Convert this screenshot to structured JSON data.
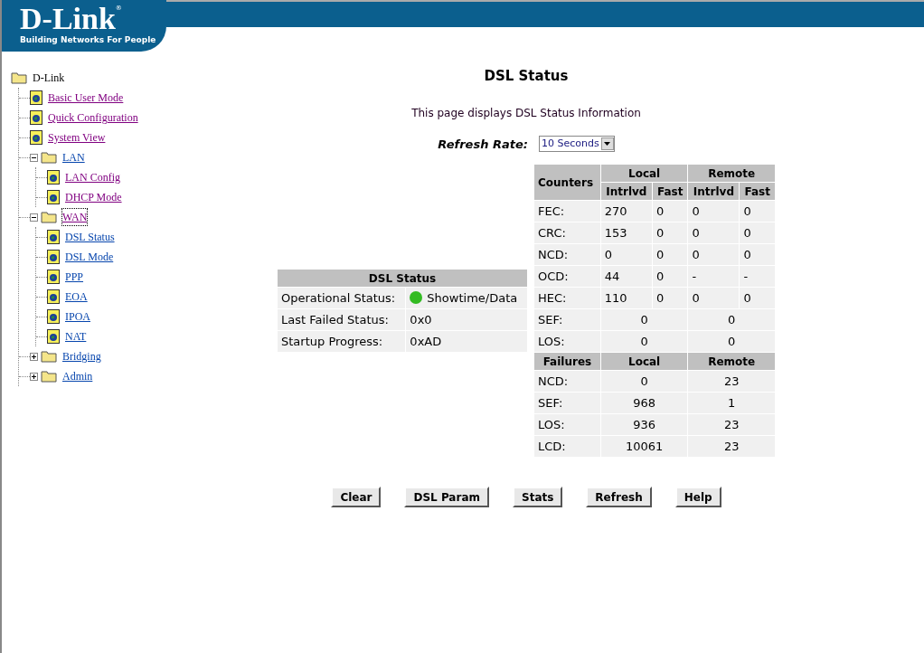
{
  "header": {
    "logo": "D-Link",
    "logo_mark": "®",
    "tagline": "Building Networks For People"
  },
  "tree": {
    "label": "D-Link",
    "children": [
      {
        "label": "Basic User Mode",
        "kind": "page",
        "visited": true,
        "focused": false
      },
      {
        "label": "Quick Configuration",
        "kind": "page",
        "visited": true,
        "focused": false
      },
      {
        "label": "System View",
        "kind": "page",
        "visited": true,
        "focused": false
      },
      {
        "label": "LAN",
        "kind": "folder",
        "expanded": true,
        "visited": false,
        "focused": false,
        "children": [
          {
            "label": "LAN Config",
            "kind": "page",
            "visited": true,
            "focused": false
          },
          {
            "label": "DHCP Mode",
            "kind": "page",
            "visited": true,
            "focused": false
          }
        ]
      },
      {
        "label": "WAN",
        "kind": "folder",
        "expanded": true,
        "visited": true,
        "focused": true,
        "children": [
          {
            "label": "DSL Status",
            "kind": "page",
            "visited": false,
            "focused": false
          },
          {
            "label": "DSL Mode",
            "kind": "page",
            "visited": false,
            "focused": false
          },
          {
            "label": "PPP",
            "kind": "page",
            "visited": false,
            "focused": false
          },
          {
            "label": "EOA",
            "kind": "page",
            "visited": false,
            "focused": false
          },
          {
            "label": "IPOA",
            "kind": "page",
            "visited": false,
            "focused": false
          },
          {
            "label": "NAT",
            "kind": "page",
            "visited": false,
            "focused": false
          }
        ]
      },
      {
        "label": "Bridging",
        "kind": "folder",
        "expanded": false,
        "visited": false,
        "focused": false
      },
      {
        "label": "Admin",
        "kind": "folder",
        "expanded": false,
        "visited": false,
        "focused": false
      }
    ]
  },
  "page": {
    "title": "DSL Status",
    "description": "This page displays DSL Status Information",
    "refresh_rate": {
      "label": "Refresh Rate:",
      "value": "10 Seconds"
    }
  },
  "status_table": {
    "title": "DSL Status",
    "rows": [
      {
        "label": "Operational Status:",
        "value": "Showtime/Data",
        "led_on": true
      },
      {
        "label": "Last Failed Status:",
        "value": "0x0"
      },
      {
        "label": "Startup Progress:",
        "value": "0xAD"
      }
    ]
  },
  "counters": {
    "heading": "Counters",
    "groups": [
      "Local",
      "Remote"
    ],
    "subheadings": [
      "Intrlvd",
      "Fast",
      "Intrlvd",
      "Fast"
    ],
    "rows": [
      {
        "kind": "split",
        "label": "FEC:",
        "values": [
          "270",
          "0",
          "0",
          "0"
        ]
      },
      {
        "kind": "split",
        "label": "CRC:",
        "values": [
          "153",
          "0",
          "0",
          "0"
        ]
      },
      {
        "kind": "split",
        "label": "NCD:",
        "values": [
          "0",
          "0",
          "0",
          "0"
        ]
      },
      {
        "kind": "split",
        "label": "OCD:",
        "values": [
          "44",
          "0",
          "-",
          "-"
        ]
      },
      {
        "kind": "split",
        "label": "HEC:",
        "values": [
          "110",
          "0",
          "0",
          "0"
        ]
      },
      {
        "kind": "merged",
        "label": "SEF:",
        "values": [
          "0",
          "0"
        ]
      },
      {
        "kind": "merged",
        "label": "LOS:",
        "values": [
          "0",
          "0"
        ]
      }
    ]
  },
  "failures": {
    "heading": "Failures",
    "groups": [
      "Local",
      "Remote"
    ],
    "rows": [
      {
        "label": "NCD:",
        "values": [
          "0",
          "23"
        ]
      },
      {
        "label": "SEF:",
        "values": [
          "968",
          "1"
        ]
      },
      {
        "label": "LOS:",
        "values": [
          "936",
          "23"
        ]
      },
      {
        "label": "LCD:",
        "values": [
          "10061",
          "23"
        ]
      }
    ]
  },
  "buttons": [
    "Clear",
    "DSL Param",
    "Stats",
    "Refresh",
    "Help"
  ]
}
